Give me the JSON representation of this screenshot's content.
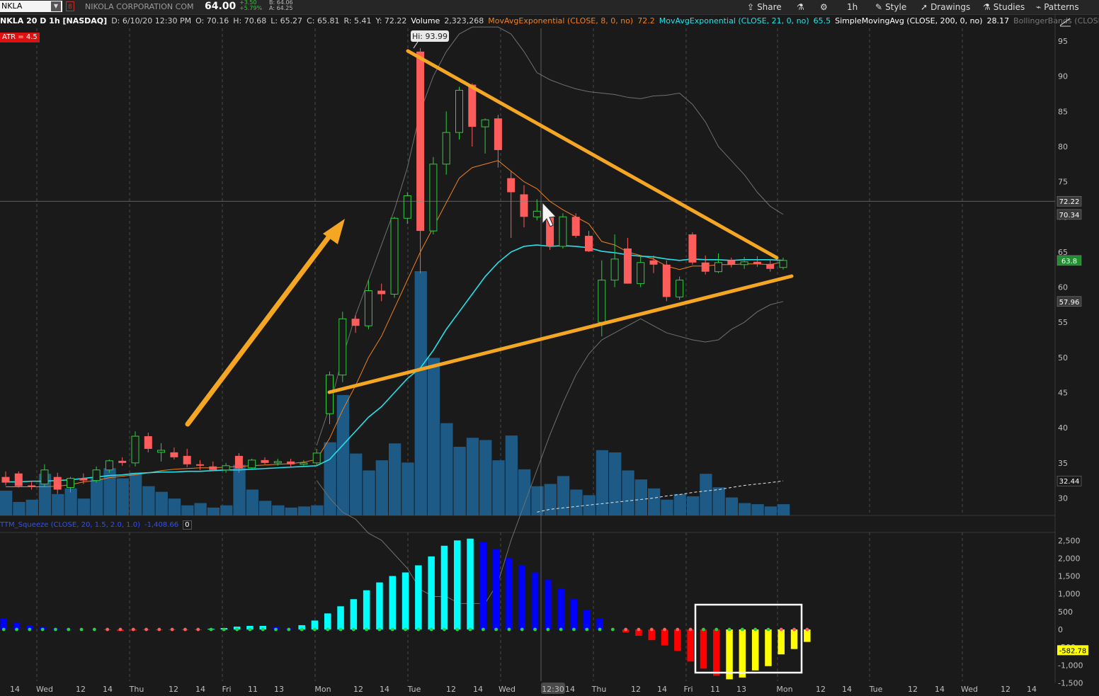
{
  "toolbar": {
    "symbol": "NKLA",
    "company": "NIKOLA CORPORATION COM",
    "last": "64.00",
    "change": "+3.50",
    "change_pct": "+5.79%",
    "bid": "B: 64.06",
    "ask": "A: 64.25",
    "interval": "1h",
    "share": "Share",
    "style": "Style",
    "drawings": "Drawings",
    "studies": "Studies",
    "patterns": "Patterns"
  },
  "study_bar": {
    "desc": "NKLA 20 D 1h [NASDAQ]",
    "date": "D: 6/10/20 12:30 PM",
    "open": "O: 70.16",
    "high": "H: 70.68",
    "low": "L: 65.27",
    "close": "C: 65.81",
    "range": "R: 5.41",
    "y": "Y: 72.22",
    "volume_label": "Volume",
    "volume_value": "2,323,268",
    "ema8_label": "MovAvgExponential (CLOSE, 8, 0, no)",
    "ema8_value": "72.2",
    "ema21_label": "MovAvgExponential (CLOSE, 21, 0, no)",
    "ema21_value": "65.5",
    "sma200_label": "SimpleMovingAvg (CLOSE, 200, 0, no)",
    "sma200_value": "28.17",
    "bb_label": "BollingerBands (CLOSE,..."
  },
  "atr_label": "ATR = 4.5",
  "squeeze_bar": {
    "label": "TTM_Squeeze (CLOSE, 20, 1.5, 2.0, 1.0)",
    "value": "-1,408.66",
    "zero": "0"
  },
  "hi_label": "Hi: 93.99",
  "crosshair_time": "12:30",
  "price_tags": [
    {
      "value": 72.22,
      "text": "72.22",
      "bg": "#3a3a3a",
      "fg": "#ffffff"
    },
    {
      "value": 70.34,
      "text": "70.34",
      "bg": "#3a3a3a",
      "fg": "#ffffff"
    },
    {
      "value": 63.8,
      "text": "63.8",
      "bg": "#1f8f2f",
      "fg": "#ffffff"
    },
    {
      "value": 57.96,
      "text": "57.96",
      "bg": "#3a3a3a",
      "fg": "#ffffff"
    },
    {
      "value": 32.44,
      "text": "32.44",
      "bg": "#1a1a1a",
      "fg": "#ffffff"
    }
  ],
  "squeeze_tag": {
    "value": -582.78,
    "text": "-582.78"
  },
  "colors": {
    "up": "#2ecc40",
    "down": "#ff5c5c",
    "volume": "#1d5a86",
    "ema8": "#f08020",
    "ema21": "#28e0e8",
    "bollinger": "#707070",
    "trend": "#f5a623",
    "sq_cyan": "#00ffff",
    "sq_blue": "#0000ff",
    "sq_red": "#ff0000",
    "sq_yellow": "#ffff00"
  },
  "chart_data": [
    {
      "type": "candlestick",
      "title": "NKLA 20 D 1h [NASDAQ]",
      "ylim": [
        27,
        97
      ],
      "yticks": [
        30,
        35,
        40,
        45,
        50,
        55,
        60,
        65,
        70,
        75,
        80,
        85,
        90,
        95
      ],
      "x_labels": [
        "14",
        "Wed",
        "12",
        "14",
        "Thu",
        "12",
        "14",
        "Fri",
        "11",
        "13",
        "Mon",
        "12",
        "14",
        "Tue",
        "12",
        "14",
        "Wed",
        "12:30",
        "14",
        "Thu",
        "12",
        "14",
        "Fri",
        "11",
        "13",
        "Mon",
        "12",
        "14",
        "Tue",
        "12",
        "14",
        "Wed",
        "12",
        "14"
      ],
      "candles": [
        [
          33.0,
          33.8,
          31.8,
          32.2
        ],
        [
          33.5,
          33.8,
          31.5,
          31.7
        ],
        [
          31.8,
          32.4,
          31.2,
          31.6
        ],
        [
          32.0,
          34.8,
          31.6,
          34.0
        ],
        [
          33.0,
          33.6,
          30.6,
          31.2
        ],
        [
          31.5,
          33.0,
          30.8,
          32.8
        ],
        [
          32.8,
          33.5,
          32.0,
          32.5
        ],
        [
          32.5,
          34.5,
          32.2,
          34.0
        ],
        [
          34.0,
          35.5,
          33.6,
          35.3
        ],
        [
          35.3,
          35.8,
          34.6,
          35.0
        ],
        [
          35.0,
          39.5,
          34.5,
          38.8
        ],
        [
          38.8,
          39.3,
          36.5,
          37.0
        ],
        [
          36.5,
          37.8,
          35.2,
          36.8
        ],
        [
          36.5,
          37.2,
          35.5,
          35.8
        ],
        [
          36.0,
          37.0,
          34.4,
          34.8
        ],
        [
          34.8,
          35.4,
          34.0,
          34.6
        ],
        [
          34.5,
          35.2,
          33.8,
          34.0
        ],
        [
          34.0,
          35.0,
          33.6,
          34.6
        ],
        [
          36.0,
          36.4,
          33.6,
          34.2
        ],
        [
          34.3,
          35.6,
          34.0,
          35.4
        ],
        [
          35.4,
          35.8,
          34.8,
          35.0
        ],
        [
          35.0,
          35.6,
          34.6,
          35.2
        ],
        [
          35.2,
          35.6,
          34.4,
          34.8
        ],
        [
          34.8,
          35.4,
          34.4,
          35.0
        ],
        [
          35.0,
          37.0,
          34.6,
          36.4
        ],
        [
          42.0,
          48.0,
          40.5,
          47.5
        ],
        [
          47.5,
          56.5,
          46.5,
          55.5
        ],
        [
          55.5,
          56.0,
          53.5,
          54.5
        ],
        [
          54.5,
          61.0,
          54.0,
          59.5
        ],
        [
          59.5,
          60.5,
          58.0,
          59.0
        ],
        [
          59.0,
          70.0,
          58.5,
          69.8
        ],
        [
          69.8,
          73.5,
          69.0,
          73.0
        ],
        [
          93.5,
          93.99,
          62.0,
          68.0
        ],
        [
          68.0,
          78.5,
          67.5,
          77.5
        ],
        [
          77.5,
          85.0,
          76.0,
          82.0
        ],
        [
          82.0,
          88.5,
          81.0,
          88.0
        ],
        [
          88.8,
          89.0,
          80.0,
          82.8
        ],
        [
          82.8,
          84.0,
          79.0,
          83.8
        ],
        [
          84.0,
          84.5,
          77.0,
          79.5
        ],
        [
          75.5,
          76.5,
          67.0,
          73.5
        ],
        [
          73.2,
          74.5,
          68.5,
          70.0
        ],
        [
          70.0,
          72.5,
          69.5,
          70.8
        ],
        [
          70.2,
          70.7,
          65.3,
          65.8
        ],
        [
          65.8,
          70.5,
          65.5,
          70.0
        ],
        [
          70.0,
          70.5,
          67.0,
          67.3
        ],
        [
          67.3,
          68.0,
          65.0,
          65.1
        ],
        [
          55.0,
          63.8,
          53.0,
          61.0
        ],
        [
          61.0,
          67.5,
          60.0,
          64.0
        ],
        [
          65.5,
          67.0,
          60.5,
          60.5
        ],
        [
          60.5,
          64.5,
          60.0,
          63.5
        ],
        [
          63.8,
          64.5,
          62.0,
          63.2
        ],
        [
          63.2,
          63.8,
          58.0,
          58.6
        ],
        [
          58.6,
          61.5,
          58.2,
          61.0
        ],
        [
          67.5,
          67.8,
          63.2,
          63.5
        ],
        [
          63.5,
          64.5,
          61.8,
          62.2
        ],
        [
          62.2,
          64.8,
          62.0,
          63.5
        ],
        [
          63.8,
          64.2,
          62.8,
          63.2
        ],
        [
          63.2,
          64.3,
          62.6,
          63.6
        ],
        [
          63.6,
          64.4,
          62.9,
          63.3
        ],
        [
          63.3,
          64.0,
          62.2,
          62.6
        ],
        [
          62.8,
          64.2,
          62.5,
          63.8
        ]
      ],
      "volume_scale_max": 420,
      "volume": [
        22,
        12,
        14,
        37,
        19,
        24,
        15,
        33,
        42,
        33,
        38,
        26,
        21,
        15,
        9,
        11,
        7,
        9,
        45,
        23,
        13,
        9,
        7,
        8,
        9,
        65,
        107,
        55,
        40,
        49,
        64,
        47,
        217,
        140,
        82,
        61,
        69,
        67,
        49,
        71,
        41,
        26,
        28,
        35,
        23,
        18,
        58,
        56,
        40,
        32,
        24,
        14,
        19,
        17,
        37,
        25,
        16,
        11,
        10,
        8,
        10
      ],
      "ema8": [
        31.6,
        31.6,
        31.6,
        31.6,
        31.7,
        31.9,
        32.3,
        32.5,
        32.9,
        33.1,
        33.3,
        33.6,
        33.9,
        34.1,
        34.2,
        34.3,
        34.3,
        34.4,
        34.5,
        34.6,
        34.7,
        34.8,
        34.9,
        35.1,
        35.5,
        38.5,
        42.5,
        46.0,
        50.0,
        53.0,
        57.0,
        61.0,
        65.0,
        68.5,
        72.0,
        75.5,
        77.0,
        77.5,
        78.0,
        76.5,
        75.0,
        74.0,
        72.2,
        71.0,
        70.0,
        69.0,
        66.5,
        66.0,
        65.0,
        64.5,
        64.0,
        63.0,
        62.5,
        63.0,
        63.0,
        63.2,
        63.2,
        63.3,
        63.3,
        63.2,
        63.6
      ],
      "ema21": [
        32.3,
        32.3,
        32.4,
        32.4,
        32.5,
        32.6,
        32.8,
        33.0,
        33.2,
        33.3,
        33.5,
        33.6,
        33.7,
        33.7,
        33.8,
        33.8,
        33.9,
        34.0,
        34.0,
        34.1,
        34.2,
        34.3,
        34.4,
        34.5,
        34.6,
        35.5,
        37.5,
        39.5,
        41.5,
        43.0,
        45.0,
        47.0,
        48.5,
        51.0,
        54.0,
        56.5,
        59.0,
        61.5,
        63.5,
        65.0,
        65.8,
        66.0,
        65.8,
        65.9,
        65.8,
        65.6,
        65.1,
        64.9,
        64.6,
        64.4,
        64.3,
        64.0,
        63.8,
        64.0,
        63.9,
        63.9,
        63.8,
        63.9,
        63.9,
        63.9,
        63.8
      ],
      "bb_upper": [
        null,
        null,
        null,
        null,
        null,
        null,
        null,
        null,
        null,
        null,
        null,
        null,
        null,
        null,
        null,
        null,
        null,
        null,
        null,
        null,
        null,
        null,
        null,
        null,
        37.5,
        43.0,
        50.0,
        56.0,
        61.0,
        66.0,
        71.0,
        77.0,
        85.0,
        90.0,
        93.5,
        96.0,
        97.0,
        97.0,
        97.0,
        96.0,
        93.5,
        90.5,
        89.5,
        88.8,
        88.2,
        87.8,
        87.6,
        87.4,
        87.0,
        86.8,
        87.2,
        87.3,
        87.6,
        86.0,
        83.5,
        80.0,
        78.0,
        76.0,
        73.5,
        71.5,
        70.34
      ],
      "bb_lower": [
        null,
        null,
        null,
        null,
        null,
        null,
        null,
        null,
        null,
        null,
        null,
        null,
        null,
        null,
        null,
        null,
        null,
        null,
        null,
        null,
        null,
        null,
        null,
        null,
        32.5,
        30.0,
        28.0,
        27.0,
        25.0,
        24.0,
        22.0,
        20.0,
        17.0,
        16.0,
        16.0,
        15.0,
        15.0,
        15.0,
        18.0,
        24.0,
        29.0,
        34.0,
        39.0,
        43.5,
        47.5,
        50.5,
        52.5,
        53.5,
        54.5,
        55.5,
        54.5,
        53.5,
        53.0,
        52.5,
        52.2,
        52.5,
        54.0,
        55.0,
        56.5,
        57.5,
        57.96
      ],
      "sma200": [
        null,
        null,
        null,
        null,
        null,
        null,
        null,
        null,
        null,
        null,
        null,
        null,
        null,
        null,
        null,
        null,
        null,
        null,
        null,
        null,
        null,
        null,
        null,
        null,
        null,
        null,
        null,
        null,
        null,
        null,
        null,
        null,
        null,
        null,
        null,
        null,
        null,
        null,
        null,
        null,
        null,
        28.0,
        28.4,
        28.6,
        28.8,
        29.0,
        29.2,
        29.4,
        29.6,
        29.8,
        30.0,
        30.3,
        30.5,
        30.8,
        31.0,
        31.2,
        31.5,
        31.8,
        32.0,
        32.2,
        32.44
      ]
    },
    {
      "type": "bar",
      "title": "TTM_Squeeze (CLOSE, 20, 1.5, 2.0, 1.0)",
      "ylim": [
        -1500,
        2750
      ],
      "yticks": [
        2500,
        2000,
        1500,
        1000,
        500,
        0,
        -500,
        -1000,
        -1500
      ],
      "values": [
        300,
        200,
        120,
        60,
        20,
        10,
        0,
        0,
        -20,
        -40,
        -30,
        -20,
        -20,
        -20,
        -20,
        -20,
        20,
        40,
        80,
        100,
        100,
        80,
        40,
        120,
        250,
        450,
        650,
        850,
        1100,
        1320,
        1500,
        1600,
        1800,
        2050,
        2350,
        2500,
        2550,
        2450,
        2250,
        2000,
        1800,
        1600,
        1400,
        1150,
        850,
        550,
        300,
        0,
        -80,
        -180,
        -300,
        -450,
        -600,
        -900,
        -1100,
        -1300,
        -1400,
        -1350,
        -1150,
        -1030,
        -700,
        -550,
        -350
      ],
      "colors": [
        "sq_blue",
        "sq_blue",
        "sq_blue",
        "sq_blue",
        "sq_blue",
        "sq_blue",
        "sq_blue",
        "sq_blue",
        "sq_red",
        "sq_red",
        "sq_red",
        "sq_red",
        "sq_red",
        "sq_red",
        "sq_red",
        "sq_red",
        "sq_cyan",
        "sq_cyan",
        "sq_cyan",
        "sq_cyan",
        "sq_cyan",
        "sq_blue",
        "sq_blue",
        "sq_cyan",
        "sq_cyan",
        "sq_cyan",
        "sq_cyan",
        "sq_cyan",
        "sq_cyan",
        "sq_cyan",
        "sq_cyan",
        "sq_cyan",
        "sq_cyan",
        "sq_cyan",
        "sq_cyan",
        "sq_cyan",
        "sq_cyan",
        "sq_blue",
        "sq_blue",
        "sq_blue",
        "sq_blue",
        "sq_blue",
        "sq_blue",
        "sq_blue",
        "sq_blue",
        "sq_blue",
        "sq_blue",
        "sq_blue",
        "sq_red",
        "sq_red",
        "sq_red",
        "sq_red",
        "sq_red",
        "sq_red",
        "sq_red",
        "sq_red",
        "sq_yellow",
        "sq_yellow",
        "sq_yellow",
        "sq_yellow",
        "sq_yellow",
        "sq_yellow",
        "sq_yellow"
      ],
      "dot_colors": [
        "up",
        "up",
        "up",
        "up",
        "up",
        "up",
        "up",
        "up",
        "down",
        "down",
        "down",
        "down",
        "down",
        "down",
        "down",
        "down",
        "up",
        "up",
        "up",
        "up",
        "up",
        "up",
        "up",
        "up",
        "up",
        "up",
        "up",
        "up",
        "up",
        "up",
        "up",
        "up",
        "up",
        "up",
        "up",
        "up",
        "up",
        "up",
        "up",
        "up",
        "up",
        "up",
        "up",
        "up",
        "up",
        "up",
        "up",
        "up",
        "down",
        "down",
        "down",
        "down",
        "down",
        "down",
        "up",
        "up",
        "up",
        "up",
        "up",
        "up",
        "down",
        "down",
        "down"
      ]
    }
  ]
}
